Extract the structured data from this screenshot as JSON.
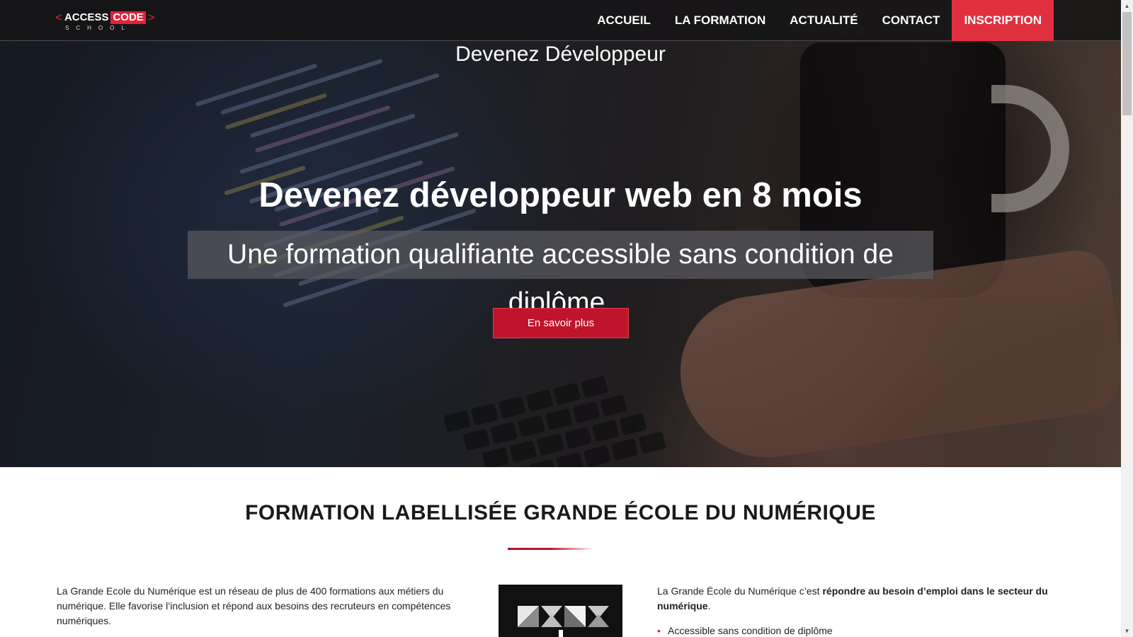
{
  "brand": {
    "logo_open": "<",
    "logo_access": "ACCESS",
    "logo_code": "CODE",
    "logo_close": ">",
    "logo_sub": "SCHOOL",
    "accent_color": "#e0223b"
  },
  "nav": {
    "items": [
      {
        "label": "ACCUEIL"
      },
      {
        "label": "LA FORMATION"
      },
      {
        "label": "ACTUALITÉ"
      },
      {
        "label": "CONTACT"
      },
      {
        "label": "INSCRIPTION"
      }
    ],
    "active_index": 4
  },
  "hero": {
    "kicker": "Devenez Développeur",
    "title": "Devenez développeur web en 8 mois",
    "subtitle": "Une formation qualifiante accessible sans condition de diplôme.",
    "cta_label": "En savoir plus"
  },
  "section": {
    "title": "FORMATION LABELLISÉE GRANDE ÉCOLE DU NUMÉRIQUE",
    "left_text": "La Grande Ecole du Numérique est un réseau de plus de 400 formations aux métiers du numérique. Elle favorise l’inclusion et répond aux besoins des recruteurs en compétences numériques.",
    "right_intro": "La Grande École du Numérique c’est ",
    "right_bold": "répondre au besoin d’emploi dans le secteur du numérique",
    "right_end": ".",
    "bullets": [
      "Accessible sans condition de diplôme"
    ]
  }
}
